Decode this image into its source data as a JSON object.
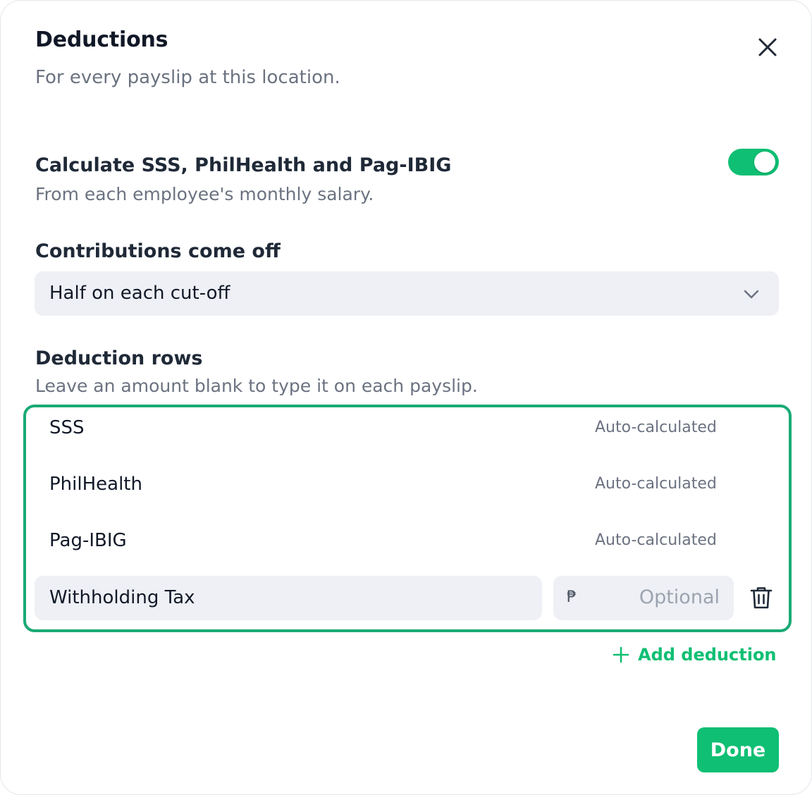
{
  "colors": {
    "accent": "#0fbf73",
    "outline": "#1aaa76"
  },
  "dialog": {
    "title": "Deductions",
    "subtitle": "For every payslip at this location.",
    "close_icon": "close-icon"
  },
  "calculate": {
    "title": "Calculate SSS, PhilHealth and Pag-IBIG",
    "description": "From each employee's monthly salary.",
    "toggle_on": true
  },
  "contributions": {
    "label": "Contributions come off",
    "selected": "Half on each cut-off",
    "icon": "chevron-down-icon"
  },
  "deduction_rows": {
    "label": "Deduction rows",
    "description": "Leave an amount blank to type it on each payslip.",
    "auto_rows": [
      {
        "name": "SSS",
        "status": "Auto-calculated"
      },
      {
        "name": "PhilHealth",
        "status": "Auto-calculated"
      },
      {
        "name": "Pag-IBIG",
        "status": "Auto-calculated"
      }
    ],
    "custom_row": {
      "name_value": "Withholding Tax",
      "currency_symbol": "₱",
      "amount_placeholder": "Optional",
      "delete_icon": "trash-icon"
    }
  },
  "add_deduction": {
    "label": "Add deduction",
    "icon": "plus-icon"
  },
  "done_label": "Done"
}
